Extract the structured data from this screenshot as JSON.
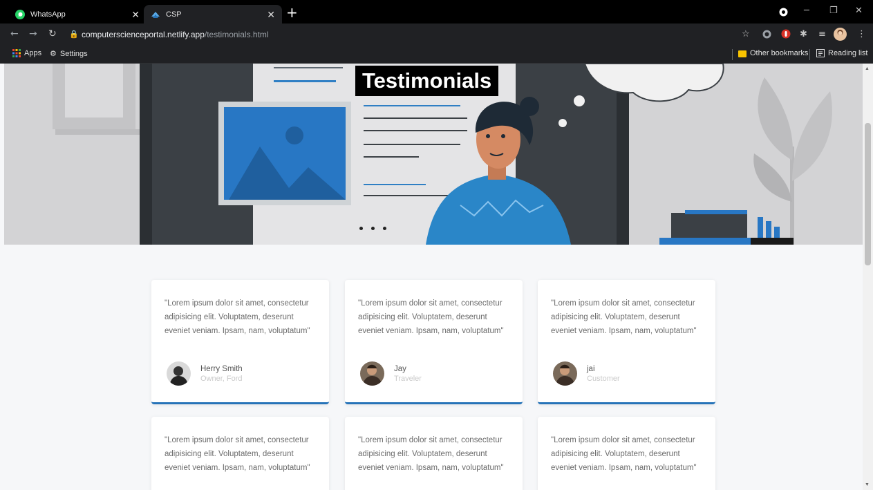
{
  "browser": {
    "tabs": [
      {
        "title": "WhatsApp",
        "active": false,
        "icon": "whatsapp-icon"
      },
      {
        "title": "CSP",
        "active": true,
        "icon": "csp-icon"
      }
    ],
    "url_host": "computerscienceportal.netlify.app",
    "url_path": "/testimonials.html",
    "bookmarks": {
      "apps": "Apps",
      "settings": "Settings",
      "other": "Other bookmarks",
      "reading": "Reading list"
    }
  },
  "hero": {
    "title": "Testimonials",
    "slides": 3
  },
  "testimonials": [
    {
      "quote": "\"Lorem ipsum dolor sit amet, consectetur adipisicing elit. Voluptatem, deserunt eveniet veniam. Ipsam, nam, voluptatum\"",
      "name": "Herry Smith",
      "role": "Owner, Ford"
    },
    {
      "quote": "\"Lorem ipsum dolor sit amet, consectetur adipisicing elit. Voluptatem, deserunt eveniet veniam. Ipsam, nam, voluptatum\"",
      "name": "Jay",
      "role": "Traveler"
    },
    {
      "quote": "\"Lorem ipsum dolor sit amet, consectetur adipisicing elit. Voluptatem, deserunt eveniet veniam. Ipsam, nam, voluptatum\"",
      "name": "jai",
      "role": "Customer"
    },
    {
      "quote": "\"Lorem ipsum dolor sit amet, consectetur adipisicing elit. Voluptatem, deserunt eveniet veniam. Ipsam, nam, voluptatum\""
    },
    {
      "quote": "\"Lorem ipsum dolor sit amet, consectetur adipisicing elit. Voluptatem, deserunt eveniet veniam. Ipsam, nam, voluptatum\""
    },
    {
      "quote": "\"Lorem ipsum dolor sit amet, consectetur adipisicing elit. Voluptatem, deserunt eveniet veniam. Ipsam, nam, voluptatum\""
    }
  ],
  "colors": {
    "accent": "#2673b8",
    "tab_bar": "#000000",
    "toolbar": "#202124"
  }
}
